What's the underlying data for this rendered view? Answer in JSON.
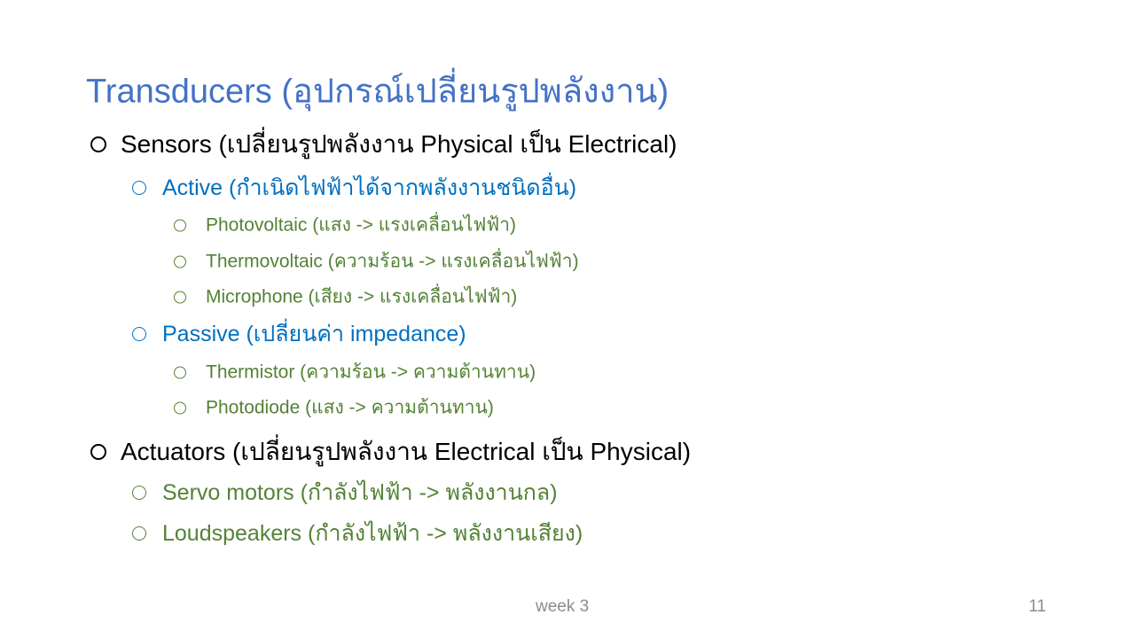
{
  "slide": {
    "title": "Transducers (อุปกรณ์เปลี่ยนรูปพลังงาน)",
    "items": [
      {
        "level": 1,
        "text": "Sensors (เปลี่ยนรูปพลังงาน  Physical  เป็น Electrical)"
      },
      {
        "level": 2,
        "text": "Active (กำเนิดไฟฟ้าได้จากพลังงานชนิดอื่น)"
      },
      {
        "level": 3,
        "text": "Photovoltaic (แสง -> แรงเคลื่อนไฟฟ้า)"
      },
      {
        "level": 3,
        "text": "Thermovoltaic (ความร้อน -> แรงเคลื่อนไฟฟ้า)"
      },
      {
        "level": 3,
        "text": "Microphone (เสียง -> แรงเคลื่อนไฟฟ้า)"
      },
      {
        "level": 2,
        "text": "Passive (เปลี่ยนค่า impedance)"
      },
      {
        "level": 3,
        "text": "Thermistor (ความร้อน -> ความต้านทาน)"
      },
      {
        "level": 3,
        "text": "Photodiode (แสง -> ความต้านทาน)"
      },
      {
        "level": 1,
        "text": "Actuators (เปลี่ยนรูปพลังงาน Electrical เป็น Physical)"
      },
      {
        "level": 2,
        "text": "Servo motors (กำลังไฟฟ้า -> พลังงานกล)"
      },
      {
        "level": 2,
        "text": "Loudspeakers (กำลังไฟฟ้า -> พลังงานเสียง)"
      }
    ],
    "footer": "week 3",
    "page_number": "11"
  },
  "colors": {
    "title": "#4472C4",
    "blue": "#0070C0",
    "green": "#548235",
    "footer": "#8c8c8c"
  }
}
